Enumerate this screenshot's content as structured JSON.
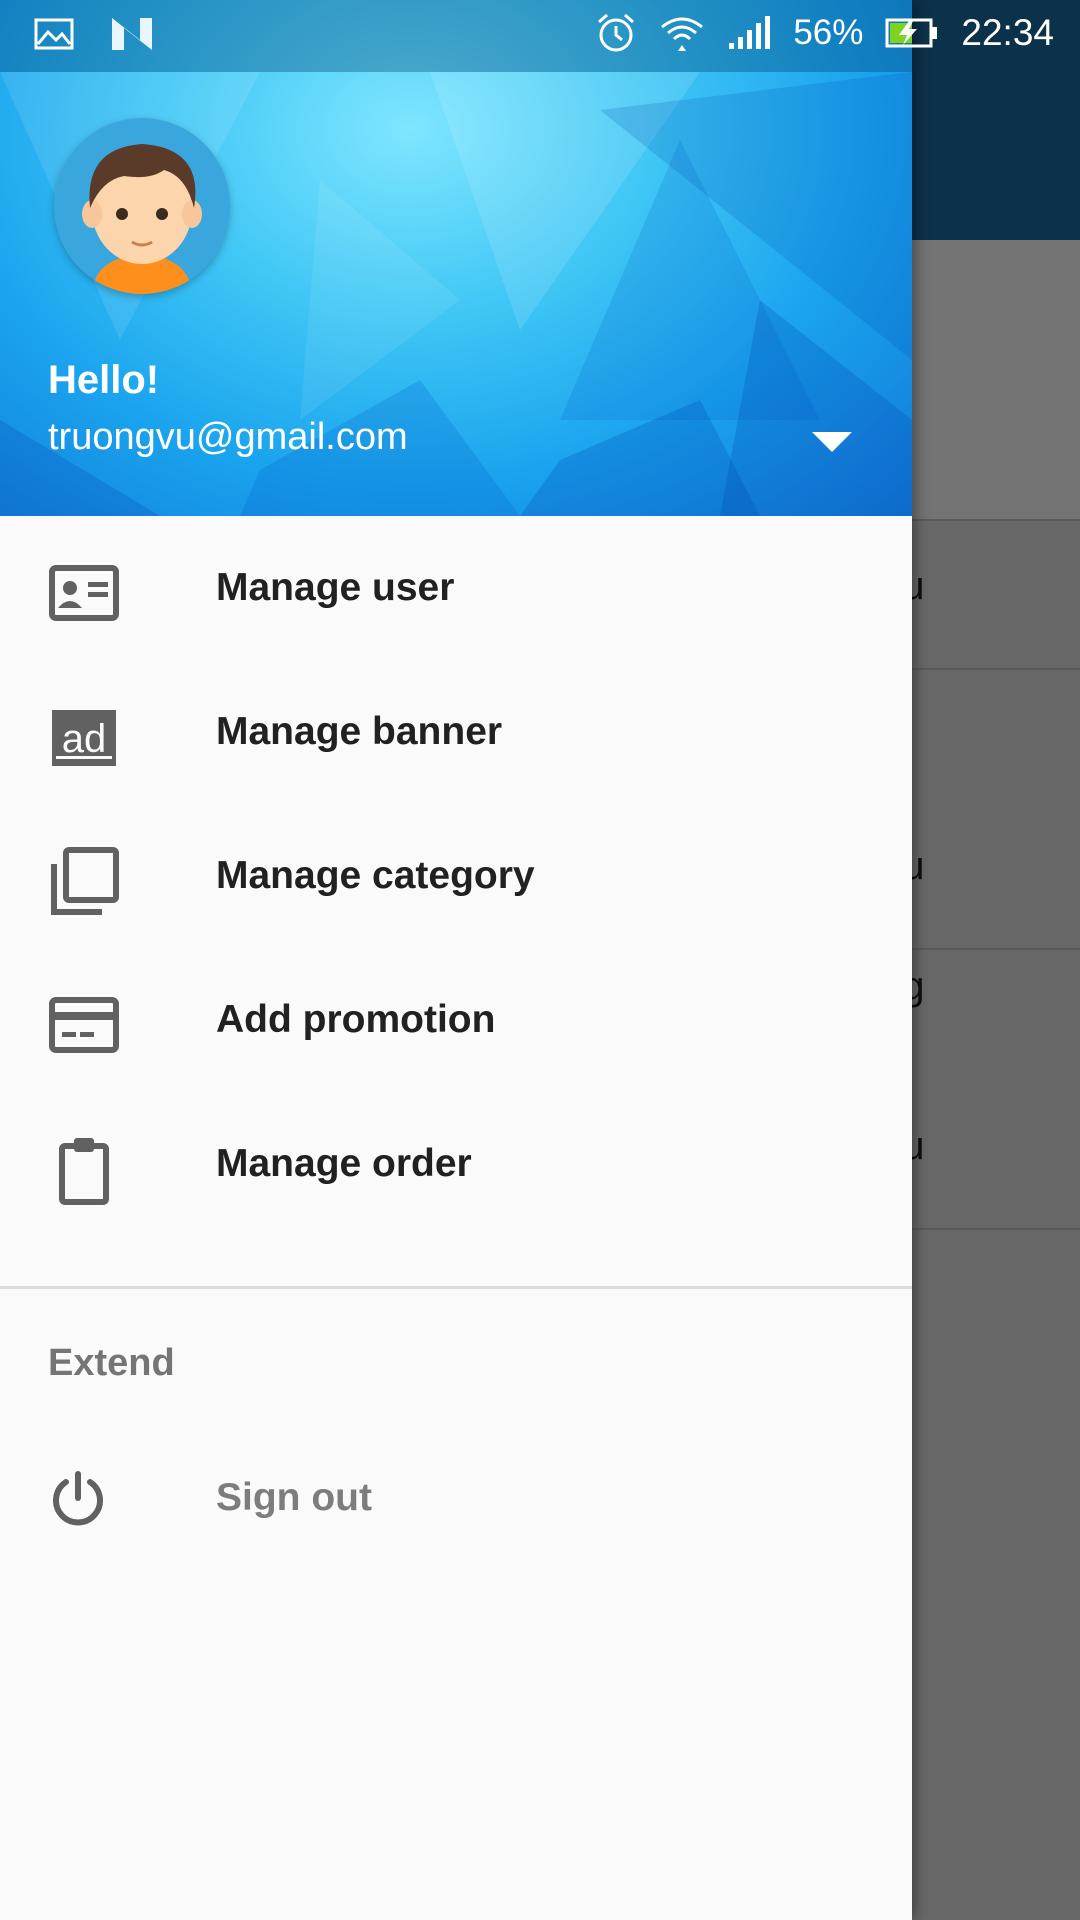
{
  "status_bar": {
    "battery_percent": "56%",
    "time": "22:34",
    "icons": [
      "image-icon",
      "n-icon",
      "alarm-icon",
      "wifi-icon",
      "signal-icon",
      "battery-charging-icon"
    ]
  },
  "drawer": {
    "header": {
      "greeting": "Hello!",
      "email": "truongvu@gmail.com",
      "dropdown_icon": "arrow-drop-down-icon"
    },
    "menu": [
      {
        "label": "Manage user",
        "icon": "id-card-icon"
      },
      {
        "label": "Manage banner",
        "icon": "ad-icon"
      },
      {
        "label": "Manage category",
        "icon": "library-icon"
      },
      {
        "label": "Add promotion",
        "icon": "card-icon"
      },
      {
        "label": "Manage order",
        "icon": "clipboard-icon"
      }
    ],
    "section_title": "Extend",
    "sign_out": {
      "label": "Sign out",
      "icon": "power-icon"
    }
  },
  "background_list": {
    "rows": [
      "au",
      "au",
      "ng",
      "au"
    ]
  },
  "colors": {
    "header_gradient_center": "#7fe6ff",
    "header_gradient_edge": "#1178d6",
    "toolbar": "#1c6ea4",
    "drawer_bg": "#fafafa",
    "menu_text": "#212121",
    "muted_text": "#757575"
  }
}
